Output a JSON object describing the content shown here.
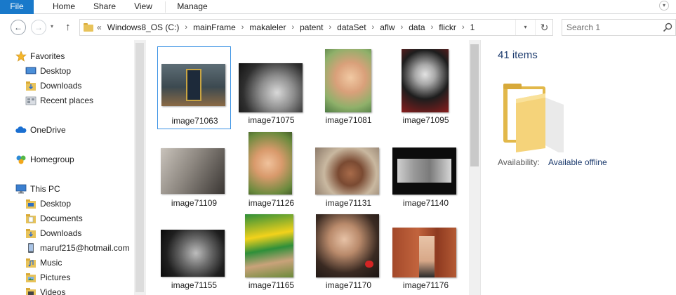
{
  "ribbon": {
    "tabs": [
      "File",
      "Home",
      "Share",
      "View",
      "Manage"
    ]
  },
  "address": {
    "lead": "«",
    "crumbs": [
      "Windows8_OS (C:)",
      "mainFrame",
      "makaleler",
      "patent",
      "dataSet",
      "aflw",
      "data",
      "flickr",
      "1"
    ]
  },
  "search": {
    "placeholder": "Search 1"
  },
  "navigation": {
    "favorites_label": "Favorites",
    "favorites": [
      "Desktop",
      "Downloads",
      "Recent places"
    ],
    "onedrive_label": "OneDrive",
    "homegroup_label": "Homegroup",
    "thispc_label": "This PC",
    "thispc_items": [
      "Desktop",
      "Documents",
      "Downloads",
      "maruf215@hotmail.com",
      "Music",
      "Pictures",
      "Videos"
    ]
  },
  "files": [
    {
      "name": "image71063",
      "selected": true
    },
    {
      "name": "image71075"
    },
    {
      "name": "image71081"
    },
    {
      "name": "image71095"
    },
    {
      "name": "image71109"
    },
    {
      "name": "image71126"
    },
    {
      "name": "image71131"
    },
    {
      "name": "image71140"
    },
    {
      "name": "image71155"
    },
    {
      "name": "image71165"
    },
    {
      "name": "image71170"
    },
    {
      "name": "image71176"
    }
  ],
  "details": {
    "item_count": "41 items",
    "availability_label": "Availability:",
    "availability_value": "Available offline"
  },
  "colors": {
    "file_tab": "#1979ca",
    "selection_border": "#3c93e4",
    "folder_yellow": "#f5d37a"
  },
  "icons": {
    "favorites": "star-icon",
    "desktop": "desktop-icon",
    "downloads": "downloads-folder-icon",
    "recent": "recent-places-icon",
    "onedrive": "onedrive-cloud-icon",
    "homegroup": "homegroup-icon",
    "thispc": "computer-icon",
    "search": "search-icon",
    "refresh": "refresh-icon"
  }
}
